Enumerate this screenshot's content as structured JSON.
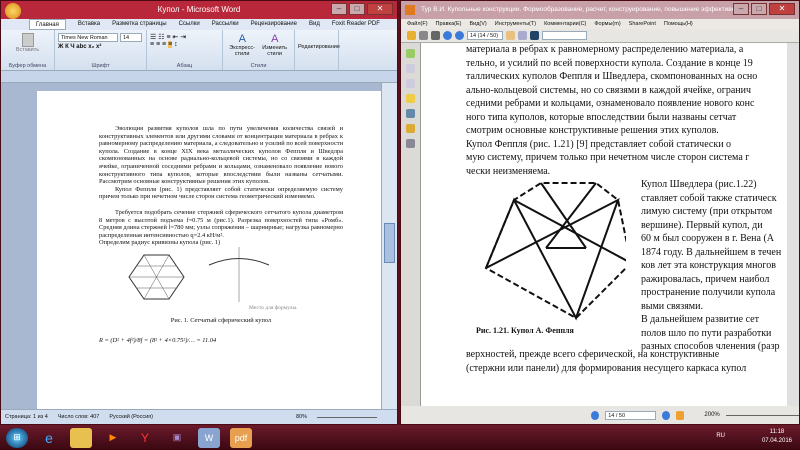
{
  "word": {
    "title": "Купол - Microsoft Word",
    "tabs": [
      "Главная",
      "Вставка",
      "Разметка страницы",
      "Ссылки",
      "Рассылки",
      "Рецензирование",
      "Вид",
      "Foxit Reader PDF"
    ],
    "font_name": "Times New Roman",
    "font_size": "14",
    "paste_label": "Вставить",
    "styles_label": "Экспресс-стили",
    "change_styles_label": "Изменить стили",
    "editing_label": "Редактирование",
    "groups": [
      "Буфер обмена",
      "Шрифт",
      "Абзац",
      "Стили"
    ],
    "paragraphs": [
      "Эволюция развития куполов шла по пути увеличения количества связей и конструктивных элементов или другими словами от концентрации материала в ребрах к равномерному распределению материала, а следовательно и усилий по всей поверхности купола. Создание в конце XIX века металлических куполов Феппля и Шведлра скомпонованных на основе радиально-кольцевой системы, но со связями в каждой ячейке, ограниченной соседними ребрами и кольцами, ознаменовало появление нового конструктивного типа куполов, которые впоследствии были названы сетчатыми. Рассмотрим основные конструктивные решения этих куполов.",
      "Купол Феппля (рис. 1) представляет собой статически определяемую систему причем только при нечетном числе сторон система геометрический изменяемо.",
      "Требуется подобрать сечение стержней сферического сетчатого купола диаметром 8 метров с высотой подъема f=0.75 м (рис.1). Разрезка поверхностей типа «Ромб». Средняя длина стержней l=780 мм; узлы сопряжения – шарнирные; нагрузка равномерно распределенная интенсивностью q=2.4 кН/м².",
      "Определим радиус кривизны купола (рис. 1)"
    ],
    "formula_placeholder": "Место для формулы.",
    "figure_caption": "Рис. 1. Сетчатый сферический купол",
    "formula": "R = (D² + 4f²)/8f = (8² + 4×0.75²)/… = 11.04",
    "status": {
      "page": "Страница: 1 из 4",
      "words": "Число слов: 407",
      "language": "Русский (Россия)",
      "zoom": "80%"
    }
  },
  "pdf": {
    "title": "Тур В.И. Купольные конструкции. Формообразование, расчет, конструирование, повышение эффективности.p...",
    "menu": [
      "Файл(F)",
      "Правка(E)",
      "Вид(V)",
      "Инструменты(T)",
      "Комментарии(C)",
      "Формы(m)",
      "SharePoint",
      "Помощь(H)"
    ],
    "page_field": "14 (14 / 50)",
    "lines_top": [
      "материала в ребрах к равномерному распределению материала, а",
      "тельно, и усилий по всей поверхности купола. Создание в конце 19",
      "таллических куполов Феппля и Шведлера, скомпонованных на осно",
      "ально-кольцевой системы, но со связями в каждой ячейке, огранич",
      "седними ребрами и кольцами, ознаменовало появление нового конс",
      "ного типа куполов, которые впоследствии были названы сетчат",
      "смотрим основные конструктивные решения этих куполов.",
      "    Купол Феппля (рис. 1.21) [9] представляет собой статически о",
      "мую систему, причем только при нечетном числе сторон система г",
      "чески неизменяема."
    ],
    "lines_right": [
      "Купол Шведлера (рис.1.22)",
      "ставляет собой также статическ",
      "лимую систему (при открытом",
      "вершине). Первый купол, ди",
      "60 м был сооружен в г. Вена (А",
      "1874 году. В дальнейшем в течен",
      "ков лет эта конструкция многов",
      "ражировалась, причем наибол",
      "пространение получили купола",
      "выми связями.",
      "    В дальнейшем развитие сет",
      "полов шло по пути разработки",
      "разных способов членения (разр"
    ],
    "lines_bottom": [
      "верхностей, прежде всего сферической, на конструктивные",
      "(стержни или панели) для формирования несущего каркаса купол"
    ],
    "figure_caption": "Рис. 1.21. Купол А. Феппля",
    "status_page": "14 / 50",
    "zoom": "200%"
  },
  "taskbar": {
    "lang": "RU",
    "time": "11:18",
    "date": "07.04.2016"
  }
}
